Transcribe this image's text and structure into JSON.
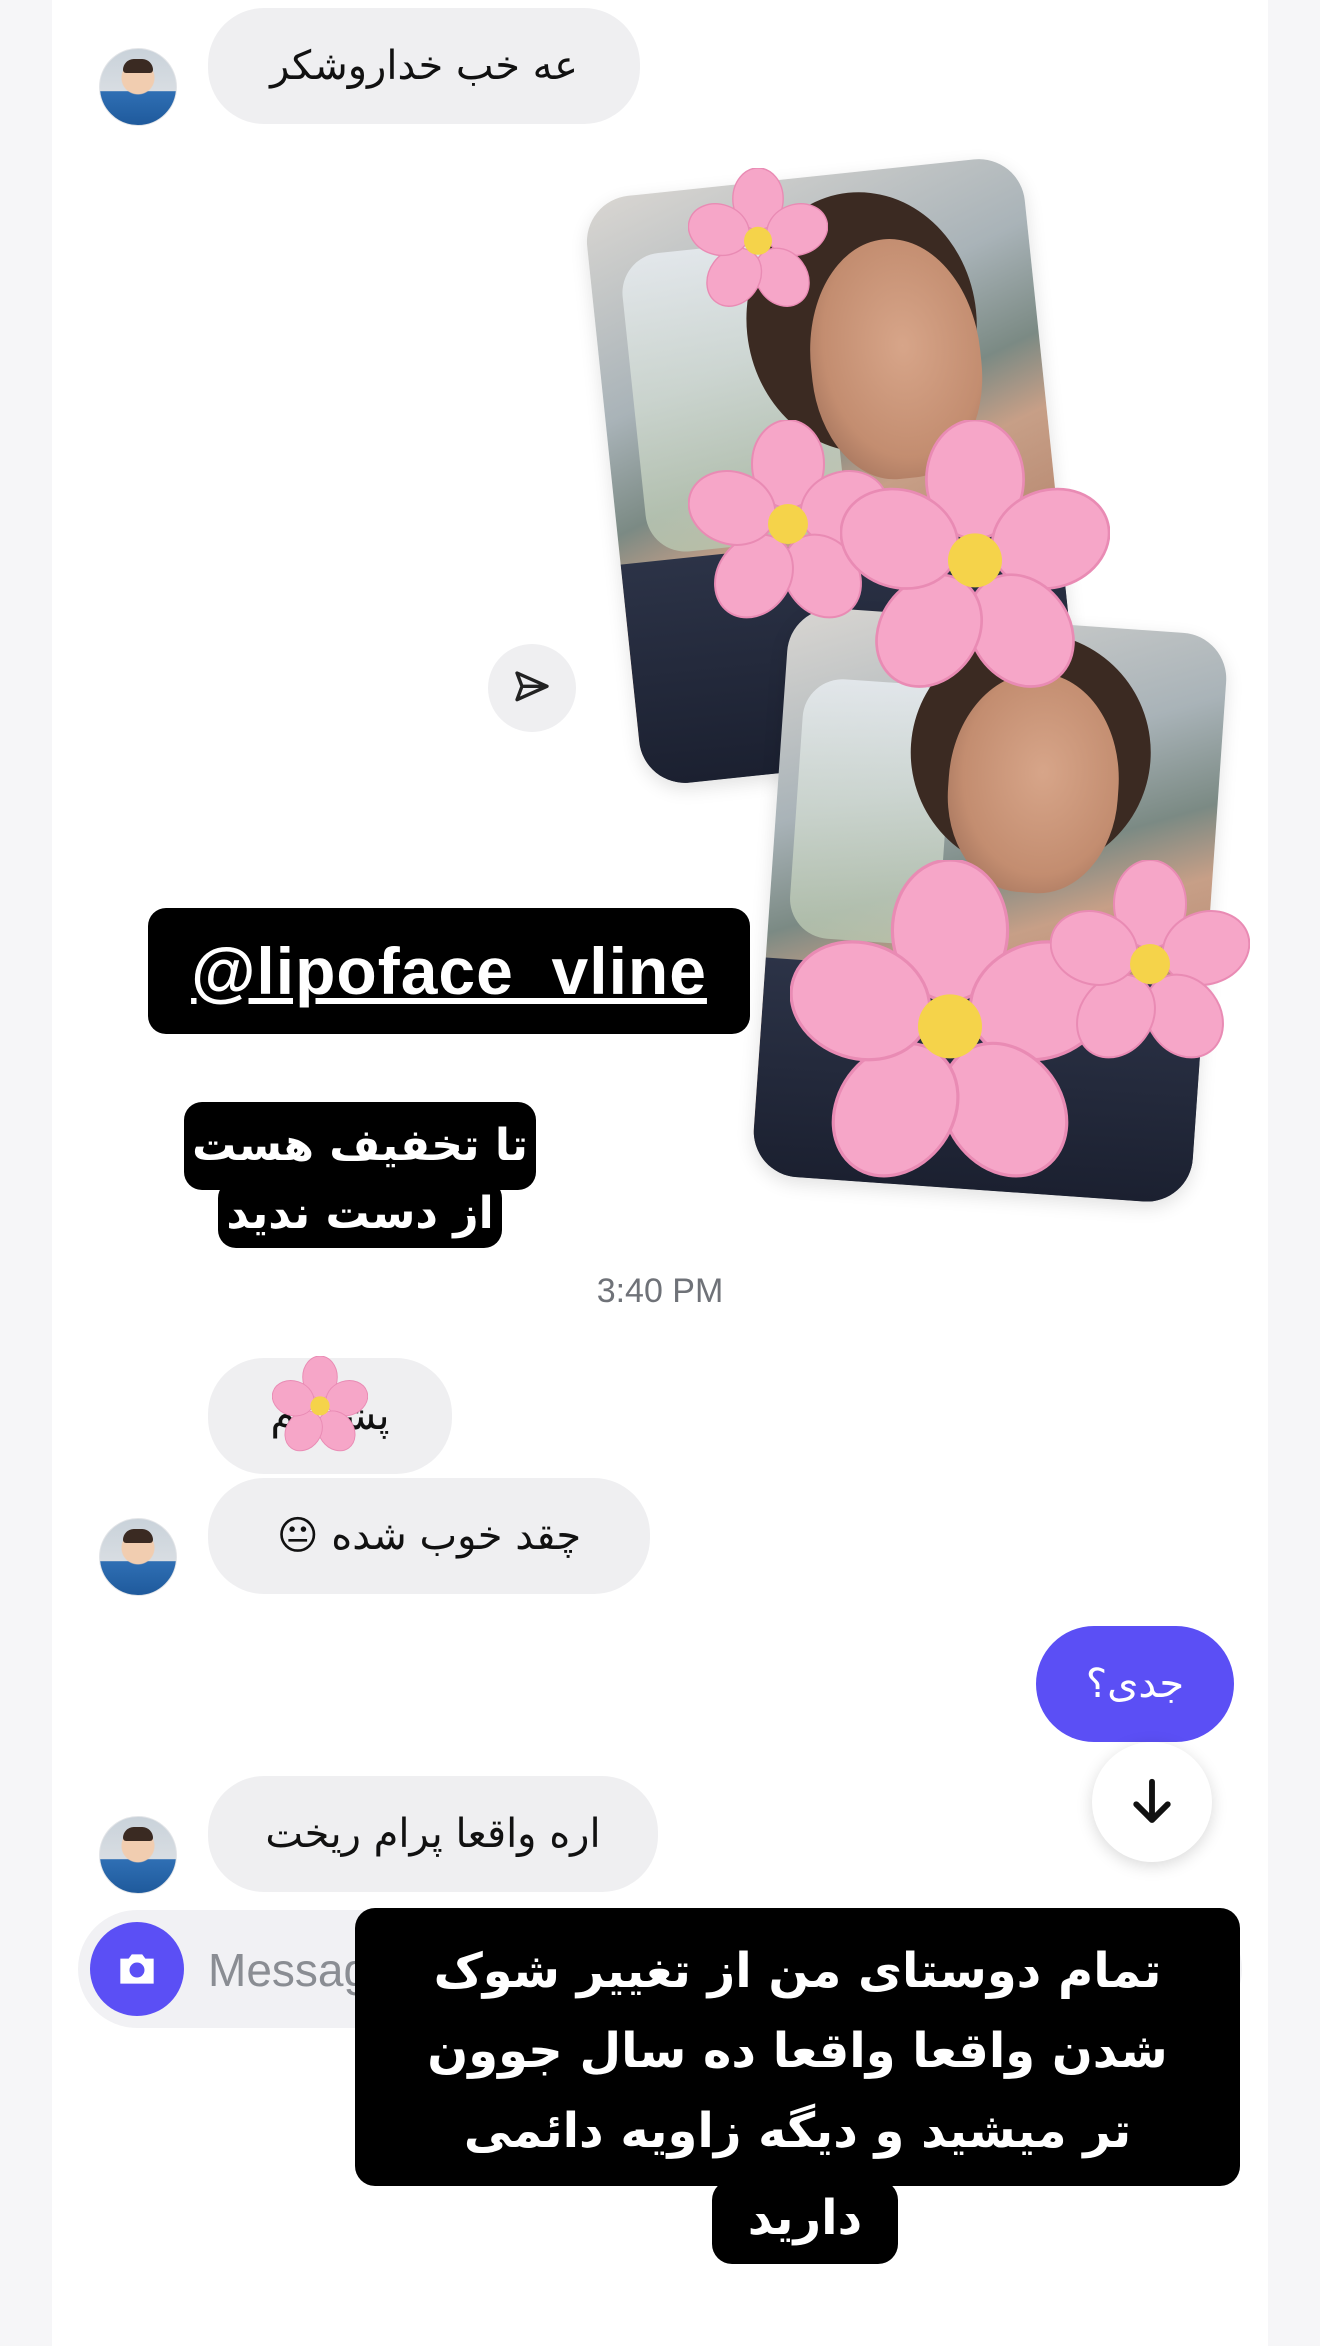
{
  "messages": {
    "m1": "عه خب خداروشکر",
    "m2": "پشیمام",
    "m3": "چقد خوب شده 😐",
    "m4": "جدی؟",
    "m5": "اره واقعا پرام ریخت"
  },
  "timestamp": "3:40 PM",
  "stickers": {
    "handle": "@lipoface_vline",
    "discount_line1": "تا تخفیف هست",
    "discount_line2": "از دست ندید",
    "testimonial_line1": "تمام دوستای من از تغییر شوک",
    "testimonial_line2": "شدن واقعا واقعا ده سال جوون",
    "testimonial_line3": "تر میشید و دیگه زاویه دائمی",
    "testimonial_line4": "دارید"
  },
  "composer": {
    "placeholder": "Message..."
  },
  "icons": {
    "share": "paper-plane-icon",
    "scroll": "arrow-down-icon",
    "camera": "camera-icon",
    "emoji": "cherry-blossom-emoji"
  },
  "colors": {
    "accent": "#5b4ff5",
    "incoming_bubble": "#efeff1",
    "sticker_bg": "#000000"
  }
}
